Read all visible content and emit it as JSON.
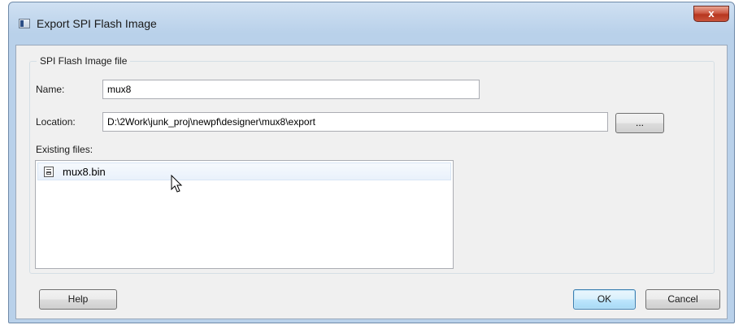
{
  "window": {
    "title": "Export SPI Flash Image",
    "close_label": "x"
  },
  "group": {
    "title": "SPI Flash Image file"
  },
  "fields": {
    "name_label": "Name:",
    "name_value": "mux8",
    "location_label": "Location:",
    "location_value": "D:\\2Work\\junk_proj\\newpf\\designer\\mux8\\export",
    "browse_label": "...",
    "existing_label": "Existing files:"
  },
  "existing_files": [
    {
      "name": "mux8.bin",
      "icon": "binary-file-icon",
      "hovered": true
    }
  ],
  "buttons": {
    "help": "Help",
    "ok": "OK",
    "cancel": "Cancel"
  }
}
